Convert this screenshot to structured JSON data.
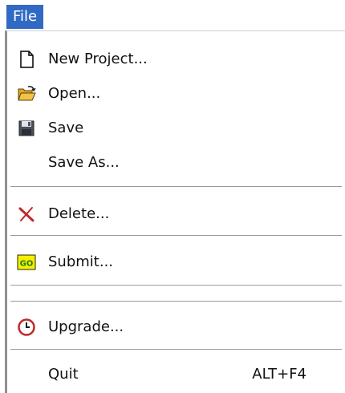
{
  "menubar": {
    "file_label": "File"
  },
  "menu": {
    "new_project": "New Project...",
    "open": "Open...",
    "save": "Save",
    "save_as": "Save As...",
    "delete": "Delete...",
    "submit": "Submit...",
    "upgrade": "Upgrade...",
    "quit": "Quit",
    "quit_shortcut": "ALT+F4"
  },
  "icons": {
    "new_project": "new-document-icon",
    "open": "open-folder-icon",
    "save": "floppy-disk-icon",
    "delete": "delete-x-icon",
    "submit": "go-icon",
    "upgrade": "clock-icon",
    "go_text": "GO"
  },
  "colors": {
    "menubar_highlight": "#316ac5",
    "delete_red": "#c0282c",
    "go_yellow": "#f7ef00",
    "go_green": "#1a7a1a",
    "folder_yellow": "#f1c24a"
  }
}
